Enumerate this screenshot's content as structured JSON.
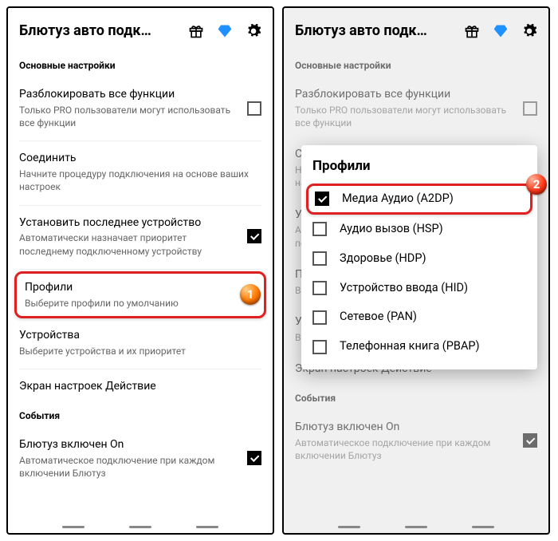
{
  "header": {
    "title": "Блютуз авто подк…"
  },
  "sections": {
    "main_label": "Основные настройки",
    "events_label": "События"
  },
  "rows": {
    "unlock": {
      "t1": "Разблокировать все функции",
      "t2": "Только PRO пользователи могут использовать все функции"
    },
    "connect": {
      "t1": "Соединить",
      "t2": "Начните процедуру подключения на основе ваших настроек"
    },
    "last_device": {
      "t1": "Установить последнее устройство",
      "t2": "Автоматически назначает приоритет последнему подключенному устройству"
    },
    "profiles": {
      "t1": "Профили",
      "t2": "Выберите профили по умолчанию"
    },
    "devices": {
      "t1": "Устройства",
      "t2": "Выберите устройства и их приоритет"
    },
    "screen": {
      "t1": "Экран настроек Действие"
    },
    "bt_on": {
      "t1": "Блютуз включен On",
      "t2": "Автоматическое подключение при каждом включении Блютуз"
    }
  },
  "dialog": {
    "title": "Профили",
    "items": [
      {
        "label": "Медиа Аудио (A2DP)",
        "checked": true
      },
      {
        "label": "Аудио вызов (HSP)",
        "checked": false
      },
      {
        "label": "Здоровье (HDP)",
        "checked": false
      },
      {
        "label": "Устройство ввода (HID)",
        "checked": false
      },
      {
        "label": "Сетевое (PAN)",
        "checked": false
      },
      {
        "label": "Телефонная книга (PBAP)",
        "checked": false
      }
    ]
  },
  "badges": {
    "one": "1",
    "two": "2"
  }
}
